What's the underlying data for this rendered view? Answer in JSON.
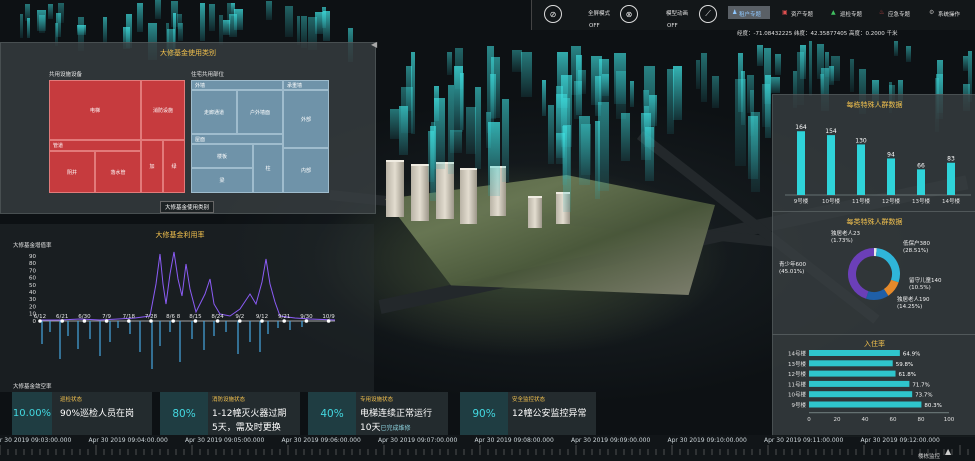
{
  "topbar": {
    "fullscreen_label": "全屏模式",
    "fullscreen_state": "OFF",
    "animation_label": "模型动画",
    "animation_state": "OFF",
    "tabs": [
      {
        "label": "租户专题",
        "active": true
      },
      {
        "label": "资产专题",
        "active": false
      },
      {
        "label": "巡检专题",
        "active": false
      },
      {
        "label": "应急专题",
        "active": false
      },
      {
        "label": "系统操作",
        "active": false
      }
    ],
    "coords": "经度：-71.08432225  纬度：42.35877405  高度：0.2000 千米"
  },
  "treemap": {
    "title": "大修基金使用类别",
    "group_public": "共用设施设备",
    "group_house": "住宅共用部位",
    "cells": {
      "elevator": "电梯",
      "fire": "消防设施",
      "pipe": "管道",
      "well": "阴井",
      "water_pipe": "落水管",
      "add": "加",
      "green": "绿",
      "wall": "外墙",
      "corridor": "走廊通道",
      "exterior": "户外墙面",
      "roof": "屋面",
      "floor_slab": "楼板",
      "beam": "梁",
      "column": "柱",
      "load_bearing": "承重墙",
      "outer": "外部",
      "inner": "内部"
    },
    "tooltip": "大修基金使用类别"
  },
  "utilization": {
    "title": "大修基金利用率",
    "ylabel_top": "大修基金增值率",
    "ylabel_bottom": "大修基金敛空率",
    "yticks": [
      "90",
      "80",
      "70",
      "60",
      "50",
      "40",
      "30",
      "20",
      "10",
      "0"
    ],
    "dates": [
      "6/12",
      "6/21",
      "6/30",
      "7/9",
      "7/18",
      "7/28",
      "8/6 8",
      "8/15",
      "8/24",
      "9/2",
      "9/12",
      "9/21",
      "9/30",
      "10/9"
    ]
  },
  "chart_data": [
    {
      "type": "bar",
      "title": "每栋特殊人群数据",
      "categories": [
        "9号楼",
        "10号楼",
        "11号楼",
        "12号楼",
        "13号楼",
        "14号楼"
      ],
      "values": [
        164,
        154,
        130,
        94,
        66,
        83
      ]
    },
    {
      "type": "pie",
      "title": "每类特殊人群数据",
      "slices": [
        {
          "name": "独居老人23",
          "value": 1.73,
          "label": "(1.73%)"
        },
        {
          "name": "低保户380",
          "value": 28.51,
          "label": "(28.51%)"
        },
        {
          "name": "留守儿童140",
          "value": 10.5,
          "label": "(10.5%)"
        },
        {
          "name": "独居老人190",
          "value": 14.25,
          "label": "(14.25%)"
        },
        {
          "name": "青少年600",
          "value": 45.01,
          "label": "(45.01%)"
        }
      ]
    },
    {
      "type": "bar",
      "title": "入住率",
      "categories": [
        "14号楼",
        "13号楼",
        "12号楼",
        "11号楼",
        "10号楼",
        "9号楼"
      ],
      "values": [
        64.9,
        59.8,
        61.8,
        71.7,
        73.7,
        80.3
      ],
      "value_labels": [
        "64.9%",
        "59.8%",
        "61.8%",
        "71.7%",
        "73.7%",
        "80.3%"
      ],
      "xticks": [
        "0",
        "20",
        "40",
        "60",
        "80",
        "100"
      ],
      "xlim": [
        0,
        100
      ]
    }
  ],
  "status": [
    {
      "pct": "10.00%",
      "label": "巡检状态",
      "main": "90%巡检人员在岗",
      "sub": ""
    },
    {
      "pct": "80%",
      "label": "消防设施状态",
      "main": "1-12幢灭火器过期",
      "sub": "5天，需及时更换"
    },
    {
      "pct": "40%",
      "label": "专用设施状态",
      "main": "电梯连续正常运行",
      "sub": "10天",
      "sub_extra": "已完成维修"
    },
    {
      "pct": "90%",
      "label": "安全监控状态",
      "main": "12幢公安监控异常",
      "sub": ""
    }
  ],
  "timeline": {
    "labels": [
      "Apr 30 2019 09:03:00.000",
      "Apr 30 2019 09:04:00.000",
      "Apr 30 2019 09:05:00.000",
      "Apr 30 2019 09:06:00.000",
      "Apr 30 2019 09:07:00.000",
      "Apr 30 2019 09:08:00.000",
      "Apr 30 2019 09:09:00.000",
      "Apr 30 2019 09:10:00.000",
      "Apr 30 2019 09:11:00.000",
      "Apr 30 2019 09:12:00.000"
    ],
    "corner": "楼栋监控"
  }
}
